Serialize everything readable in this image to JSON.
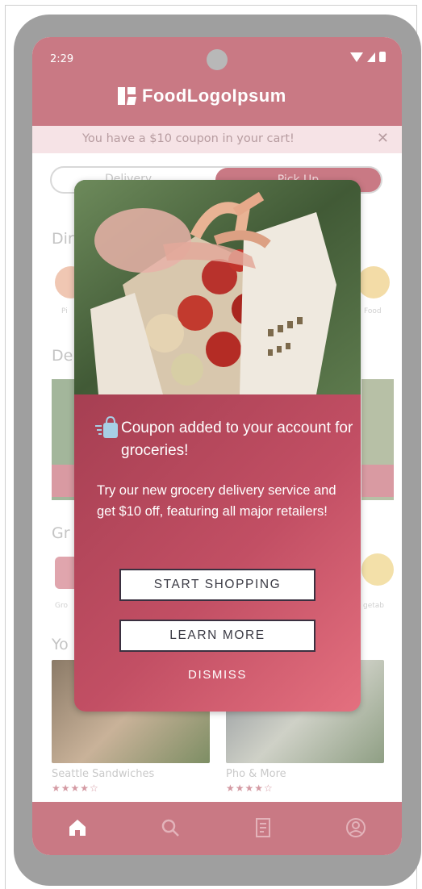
{
  "status_bar": {
    "time": "2:29"
  },
  "header": {
    "logo_text": "FoodLogoIpsum"
  },
  "coupon_banner": {
    "text": "You have a $10 coupon in your cart!",
    "close": "✕"
  },
  "order_toggle": {
    "delivery": "Delivery",
    "pickup": "Pick Up"
  },
  "background_sections": {
    "section1_heading": "Dir",
    "section2_heading": "De",
    "section3_heading": "Gr",
    "section4_heading": "Yo",
    "label_left_row1": "Pi",
    "label_right_row1": "Food",
    "label_left_row3": "Gro",
    "label_right_row3": "getab"
  },
  "restaurants": [
    {
      "name": "Seattle Sandwiches",
      "rating_stars": "★★★★☆"
    },
    {
      "name": "Pho & More",
      "rating_stars": "★★★★☆"
    }
  ],
  "bottom_nav": [
    "home-icon",
    "search-icon",
    "receipt-icon",
    "account-icon"
  ],
  "modal": {
    "title": "Coupon added to your account for groceries!",
    "description": "Try our new grocery delivery service and get $10 off, featuring all major retailers!",
    "start_shopping": "START SHOPPING",
    "learn_more": "LEARN MORE",
    "dismiss": "DISMISS"
  },
  "colors": {
    "brand": "#c97984",
    "modal_gradient_start": "#a63f52",
    "modal_gradient_end": "#e4707f"
  }
}
